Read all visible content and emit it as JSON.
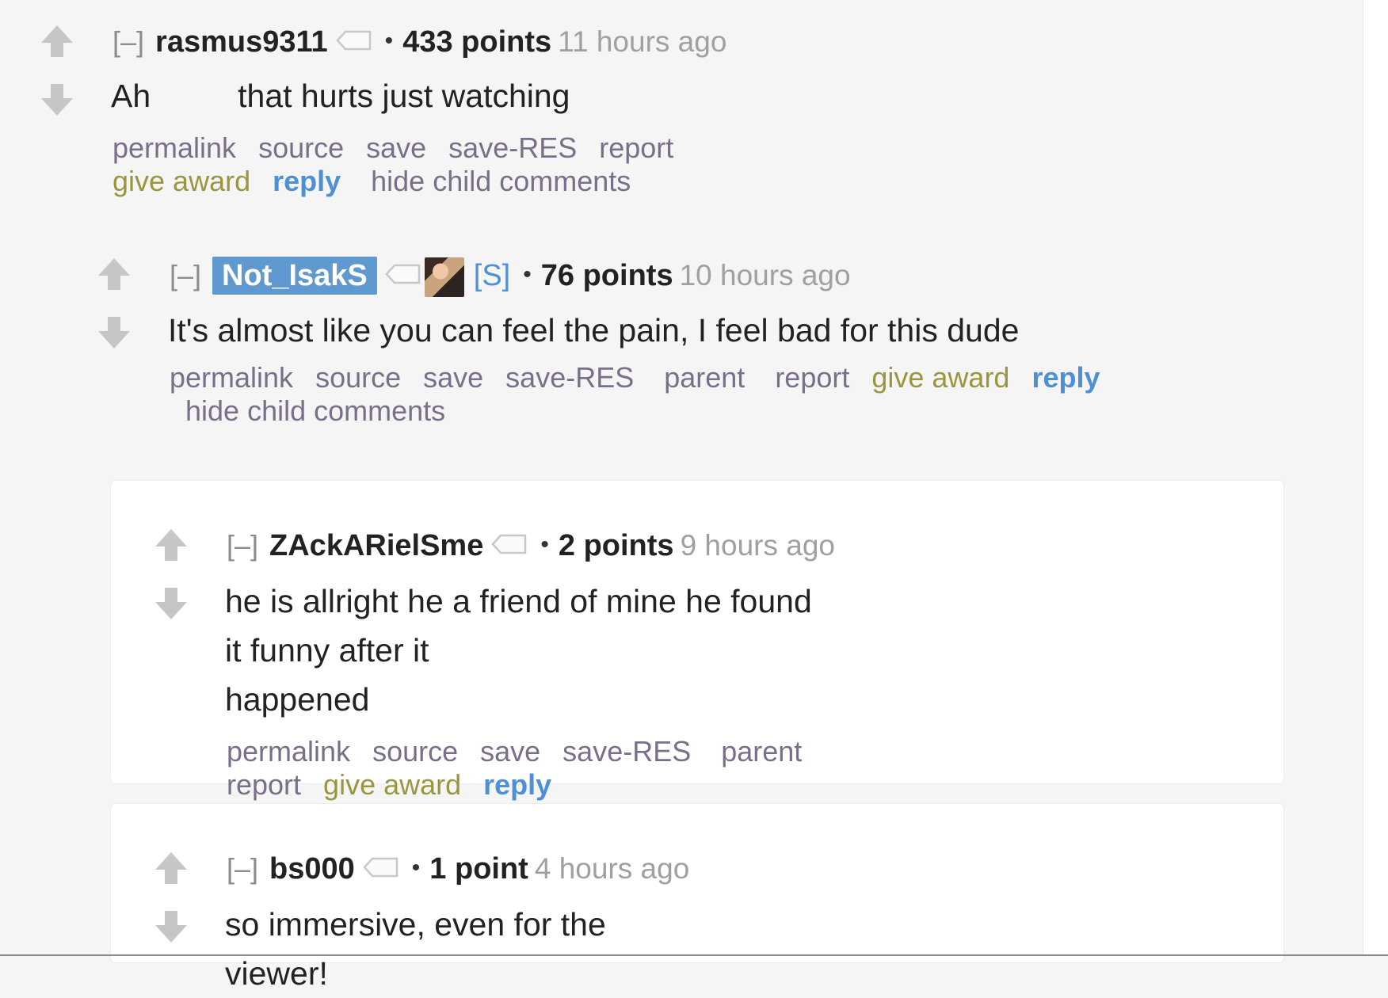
{
  "comments": [
    {
      "expand": "[–]",
      "author": "rasmus9311",
      "score": "433 points",
      "time": "11 hours ago",
      "body_start": "Ah",
      "body_end": "that hurts just watching",
      "buttons": {
        "permalink": "permalink",
        "source": "source",
        "save": "save",
        "save_res": "save-RES",
        "report": "report",
        "give_award": "give award",
        "reply": "reply",
        "hide_child": "hide child comments"
      }
    },
    {
      "expand": "[–]",
      "author": "Not_IsakS",
      "submitter_tag": "[S]",
      "score": "76 points",
      "time": "10 hours ago",
      "body": "It's almost like you can feel the pain, I feel bad for this dude",
      "buttons": {
        "permalink": "permalink",
        "source": "source",
        "save": "save",
        "save_res": "save-RES",
        "parent": "parent",
        "report": "report",
        "give_award": "give award",
        "reply": "reply",
        "hide_child": "hide child comments"
      }
    },
    {
      "expand": "[–]",
      "author": "ZAckARielSme",
      "score": "2 points",
      "time": "9 hours ago",
      "body_line1": "he is allright he a friend of mine he found it funny after it",
      "body_line2": "happened",
      "buttons": {
        "permalink": "permalink",
        "source": "source",
        "save": "save",
        "save_res": "save-RES",
        "parent": "parent",
        "report": "report",
        "give_award": "give award",
        "reply": "reply"
      }
    },
    {
      "expand": "[–]",
      "author": "bs000",
      "score": "1 point",
      "time": "4 hours ago",
      "body": "so immersive, even for the viewer!"
    }
  ],
  "colors": {
    "background": "#f5f5f5",
    "op_badge": "#5f99cf",
    "reply": "#4f8fd6",
    "award": "#9a9640",
    "buttons": "#7a6f8a"
  },
  "icons": {
    "upvote": "up-arrow-icon",
    "downvote": "down-arrow-icon",
    "tag": "tag-icon"
  }
}
